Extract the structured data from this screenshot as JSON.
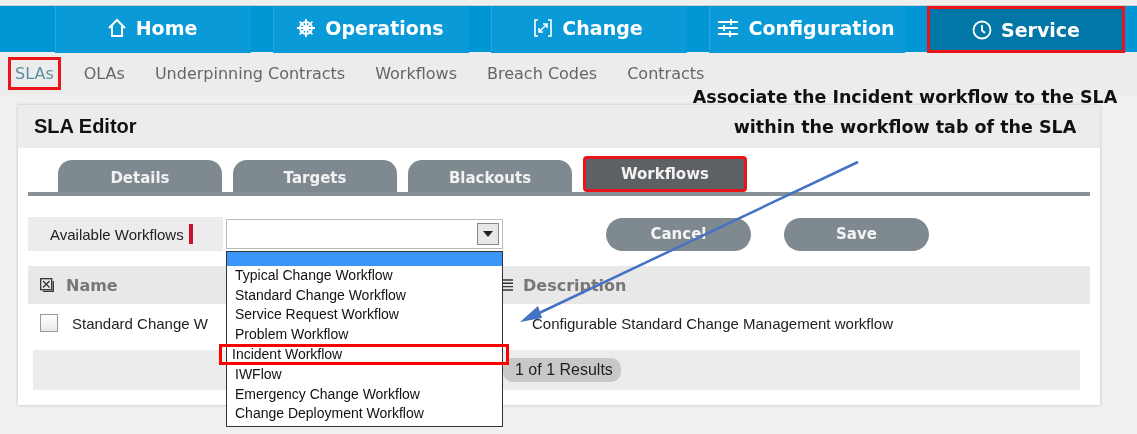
{
  "nav": {
    "tabs": [
      {
        "label": "Home",
        "kind": "home",
        "selected": false,
        "highlighted": false
      },
      {
        "label": "Operations",
        "kind": "wheel",
        "selected": false,
        "highlighted": false
      },
      {
        "label": "Change",
        "kind": "change",
        "selected": false,
        "highlighted": false
      },
      {
        "label": "Configuration",
        "kind": "sliders",
        "selected": false,
        "highlighted": false
      },
      {
        "label": "Service",
        "kind": "clock",
        "selected": true,
        "highlighted": true
      }
    ]
  },
  "subnav": {
    "items": [
      {
        "label": "SLAs",
        "selected": true,
        "highlighted": true
      },
      {
        "label": "OLAs",
        "selected": false,
        "highlighted": false
      },
      {
        "label": "Underpinning Contracts",
        "selected": false,
        "highlighted": false
      },
      {
        "label": "Workflows",
        "selected": false,
        "highlighted": false
      },
      {
        "label": "Breach Codes",
        "selected": false,
        "highlighted": false
      },
      {
        "label": "Contracts",
        "selected": false,
        "highlighted": false
      }
    ]
  },
  "annotation": {
    "lines": [
      "Associate the Incident workflow to the SLA",
      "within the workflow tab of the SLA"
    ]
  },
  "editor": {
    "title": "SLA Editor",
    "tabs": [
      {
        "label": "Details",
        "selected": false,
        "highlighted": false
      },
      {
        "label": "Targets",
        "selected": false,
        "highlighted": false
      },
      {
        "label": "Blackouts",
        "selected": false,
        "highlighted": false
      },
      {
        "label": "Workflows",
        "selected": true,
        "highlighted": true
      }
    ],
    "available_workflows": {
      "label": "Available Workflows",
      "required": true,
      "expanded": true,
      "options": [
        {
          "label": "Typical Change Workflow",
          "highlighted": false
        },
        {
          "label": "Standard Change Workflow",
          "highlighted": false
        },
        {
          "label": "Service Request Workflow",
          "highlighted": false
        },
        {
          "label": "Problem Workflow",
          "highlighted": false
        },
        {
          "label": "Incident Workflow",
          "highlighted": true
        },
        {
          "label": "IWFlow",
          "highlighted": false
        },
        {
          "label": "Emergency Change Workflow",
          "highlighted": false
        },
        {
          "label": "Change Deployment Workflow",
          "highlighted": false
        }
      ]
    },
    "buttons": [
      "Cancel",
      "Save"
    ],
    "table": {
      "columns": [
        "Name",
        "Description"
      ],
      "rows": [
        {
          "checked": false,
          "name": "Standard Change W",
          "description": "Configurable Standard Change Management workflow"
        }
      ]
    },
    "pager": "1 of 1 Results"
  }
}
